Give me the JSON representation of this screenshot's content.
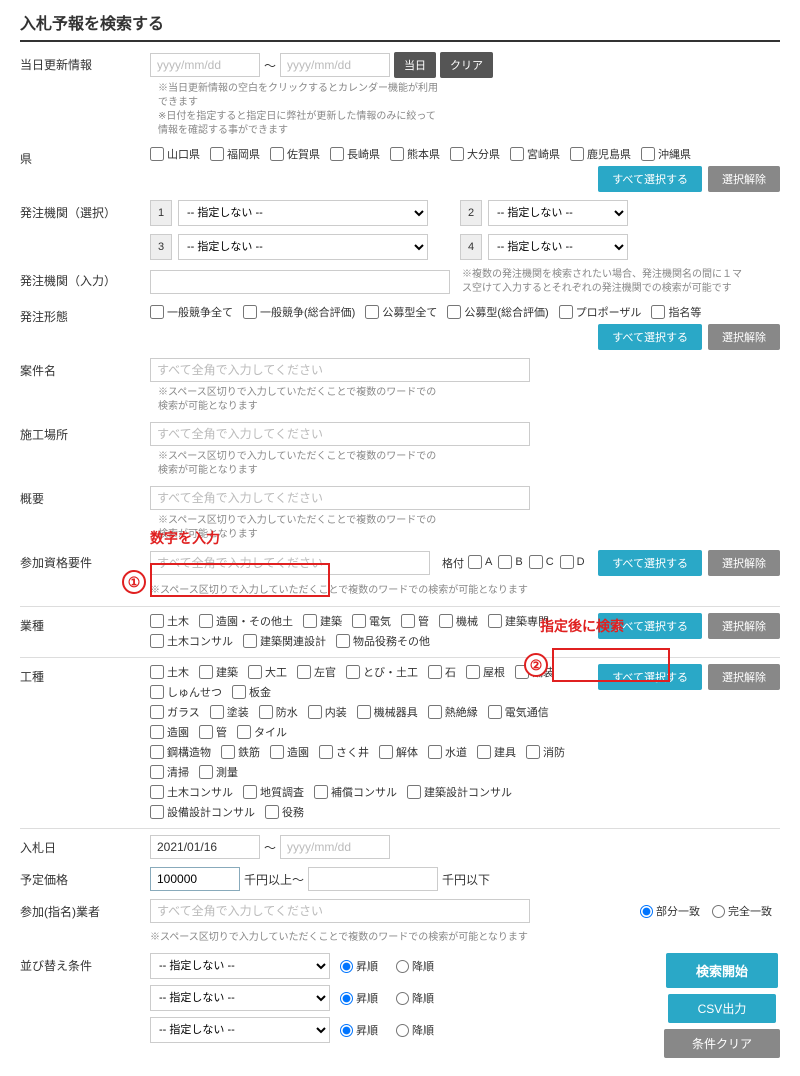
{
  "title": "入札予報を検索する",
  "updateInfo": {
    "label": "当日更新情報",
    "datePlaceholder": "yyyy/mm/dd",
    "tilde": "～",
    "btnToday": "当日",
    "btnClear": "クリア",
    "note": "※当日更新情報の空白をクリックするとカレンダー機能が利用できます\n※日付を指定すると指定日に弊社が更新した情報のみに絞って情報を確認する事ができます"
  },
  "btnSelectAll": "すべて選択する",
  "btnDeselect": "選択解除",
  "pref": {
    "label": "県",
    "items": [
      "山口県",
      "福岡県",
      "佐賀県",
      "長崎県",
      "熊本県",
      "大分県",
      "宮崎県",
      "鹿児島県",
      "沖縄県"
    ]
  },
  "agencySelect": {
    "label": "発注機関（選択）",
    "noSelect": "-- 指定しない --",
    "nums": [
      "1",
      "2",
      "3",
      "4"
    ]
  },
  "agencyInput": {
    "label": "発注機関（入力）",
    "note": "※複数の発注機関を検索されたい場合、発注機関名の間に１マス空けて入力するとそれぞれの発注機関での検索が可能です"
  },
  "orderType": {
    "label": "発注形態",
    "items": [
      "一般競争全て",
      "一般競争(総合評価)",
      "公募型全て",
      "公募型(総合評価)",
      "プロポーザル",
      "指名等"
    ]
  },
  "caseName": {
    "label": "案件名",
    "placeholder": "すべて全角で入力してください",
    "note": "※スペース区切りで入力していただくことで複数のワードでの検索が可能となります"
  },
  "place": {
    "label": "施工場所",
    "placeholder": "すべて全角で入力してください",
    "note": "※スペース区切りで入力していただくことで複数のワードでの検索が可能となります"
  },
  "summary": {
    "label": "概要",
    "placeholder": "すべて全角で入力してください",
    "note": "※スペース区切りで入力していただくことで複数のワードでの検索が可能となります"
  },
  "qualif": {
    "label": "参加資格要件",
    "placeholder": "すべて全角で入力してください",
    "kakuduke": "格付",
    "grades": [
      "A",
      "B",
      "C",
      "D"
    ],
    "note": "※スペース区切りで入力していただくことで複数のワードでの検索が可能となります"
  },
  "gyoshu": {
    "label": "業種",
    "items": [
      "土木",
      "造園・その他土",
      "建築",
      "電気",
      "管",
      "機械",
      "建築専門",
      "土木コンサル",
      "建築関連設計",
      "物品役務その他"
    ]
  },
  "koshu": {
    "label": "工種",
    "row1": [
      "土木",
      "建築",
      "大工",
      "左官",
      "とび・土工",
      "石",
      "屋根",
      "舗装",
      "しゅんせつ",
      "板金"
    ],
    "row2": [
      "ガラス",
      "塗装",
      "防水",
      "内装",
      "機械器具",
      "熱絶縁",
      "電気通信",
      "造園",
      "管",
      "タイル"
    ],
    "row3": [
      "鋼構造物",
      "鉄筋",
      "造園",
      "さく井",
      "解体",
      "水道",
      "建具",
      "消防",
      "清掃",
      "測量"
    ],
    "row4": [
      "土木コンサル",
      "地質調査",
      "補償コンサル",
      "建築設計コンサル",
      "設備設計コンサル",
      "役務"
    ]
  },
  "bidDate": {
    "label": "入札日",
    "from": "2021/01/16",
    "tilde": "～",
    "placeholder": "yyyy/mm/dd"
  },
  "price": {
    "label": "予定価格",
    "value": "100000",
    "unitFrom": "千円以上～",
    "unitTo": "千円以下"
  },
  "participant": {
    "label": "参加(指名)業者",
    "placeholder": "すべて全角で入力してください",
    "partial": "部分一致",
    "exact": "完全一致",
    "note": "※スペース区切りで入力していただくことで複数のワードでの検索が可能となります"
  },
  "sort": {
    "label": "並び替え条件",
    "noSelect": "-- 指定しない --",
    "asc": "昇順",
    "desc": "降順"
  },
  "actions": {
    "search": "検索開始",
    "csv": "CSV出力",
    "clear": "条件クリア"
  },
  "annot": {
    "numInput": "数字を入力",
    "afterSpec": "指定後に検索",
    "one": "①",
    "two": "②"
  }
}
